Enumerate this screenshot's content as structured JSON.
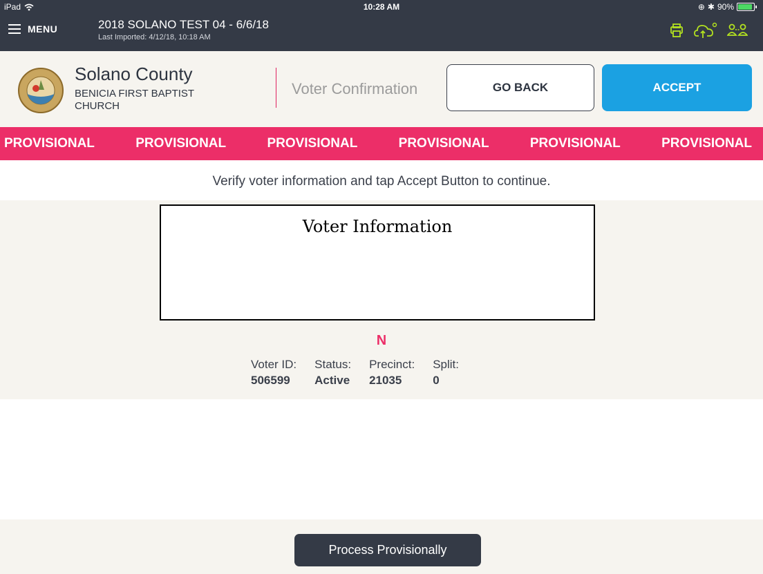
{
  "status_bar": {
    "device": "iPad",
    "time": "10:28 AM",
    "battery_percent": "90%",
    "battery_level": 0.9
  },
  "nav": {
    "menu_label": "MENU",
    "title": "2018 SOLANO TEST 04 - 6/6/18",
    "subtitle": "Last Imported: 4/12/18, 10:18 AM",
    "icons": [
      "printer-icon",
      "cloud-upload-icon",
      "users-icon"
    ],
    "icon_color": "#b4e31f"
  },
  "header": {
    "county_name": "Solano County",
    "location": "BENICIA FIRST BAPTIST CHURCH",
    "screen_title": "Voter Confirmation",
    "go_back_label": "GO BACK",
    "accept_label": "ACCEPT",
    "accent_color": "#1ba1e2"
  },
  "banner": {
    "items": [
      "PROVISIONAL",
      "PROVISIONAL",
      "PROVISIONAL",
      "PROVISIONAL",
      "PROVISIONAL",
      "PROVISIONAL"
    ],
    "color": "#ec2e68"
  },
  "instruction": "Verify voter information and tap Accept Button to continue.",
  "voter": {
    "box_title": "Voter Information",
    "letter": "N",
    "fields": [
      {
        "label": "Voter ID:",
        "value": "506599"
      },
      {
        "label": "Status:",
        "value": "Active"
      },
      {
        "label": "Precinct:",
        "value": "21035"
      },
      {
        "label": "Split:",
        "value": "0"
      }
    ]
  },
  "footer": {
    "process_label": "Process Provisionally"
  }
}
